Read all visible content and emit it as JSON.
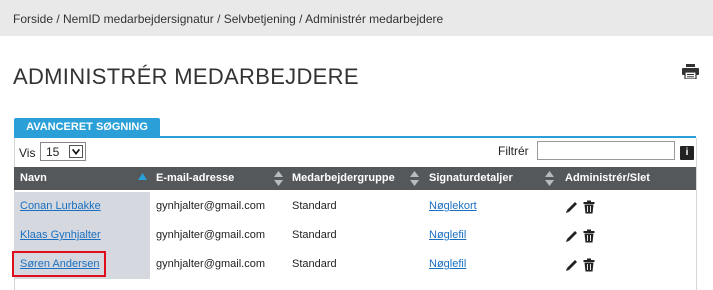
{
  "breadcrumb": "Forside / NemID medarbejdersignatur / Selvbetjening / Administrér medarbejdere",
  "page_title": "ADMINISTRÉR MEDARBEJDERE",
  "advanced_search_tab": "AVANCERET SØGNING",
  "controls": {
    "show_label": "Vis",
    "page_size": "15",
    "filter_label": "Filtrér",
    "filter_value": "",
    "info_icon": "i"
  },
  "columns": [
    "Navn",
    "E-mail-adresse",
    "Medarbejdergruppe",
    "Signaturdetaljer",
    "Administrér/Slet"
  ],
  "rows": [
    {
      "name": "Conan Lurbakke",
      "email": "gynhjalter@gmail.com",
      "group": "Standard",
      "signature": "Nøglekort"
    },
    {
      "name": "Klaas Gynhjalter",
      "email": "gynhjalter@gmail.com",
      "group": "Standard",
      "signature": "Nøglefil"
    },
    {
      "name": "Søren Andersen",
      "email": "gynhjalter@gmail.com",
      "group": "Standard",
      "signature": "Nøglefil"
    }
  ],
  "sort_column": "Navn",
  "sort_direction": "ascending",
  "colors": {
    "accent": "#2a9fd8",
    "header_bg": "#55585b",
    "sort_active": "#2a9fd8",
    "highlight": "#e0101a",
    "link": "#1a6fc0"
  },
  "icons": [
    "printer-icon",
    "chevron-down-icon",
    "info-icon",
    "sort-asc-icon",
    "sort-both-icon",
    "pencil-icon",
    "trash-icon"
  ]
}
